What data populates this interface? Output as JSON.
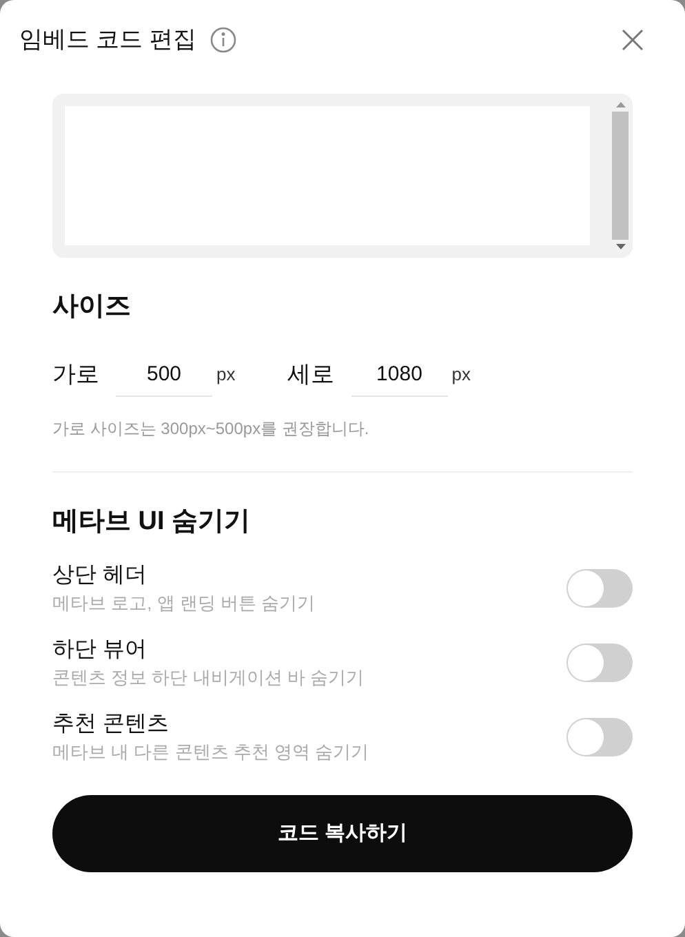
{
  "dialog": {
    "title": "임베드 코드 편집"
  },
  "size": {
    "heading": "사이즈",
    "width": {
      "label": "가로",
      "value": "500",
      "unit": "px"
    },
    "height": {
      "label": "세로",
      "value": "1080",
      "unit": "px"
    },
    "hint": "가로 사이즈는 300px~500px를 권장합니다."
  },
  "hide_ui": {
    "heading": "메타브 UI 숨기기",
    "options": [
      {
        "label": "상단 헤더",
        "description": "메타브 로고, 앱 랜딩 버튼 숨기기",
        "on": false
      },
      {
        "label": "하단 뷰어",
        "description": "콘텐츠 정보 하단 내비게이션 바 숨기기",
        "on": false
      },
      {
        "label": "추천 콘텐츠",
        "description": "메타브 내 다른 콘텐츠 추천 영역 숨기기",
        "on": false
      }
    ]
  },
  "copy_button": {
    "label": "코드 복사하기"
  }
}
